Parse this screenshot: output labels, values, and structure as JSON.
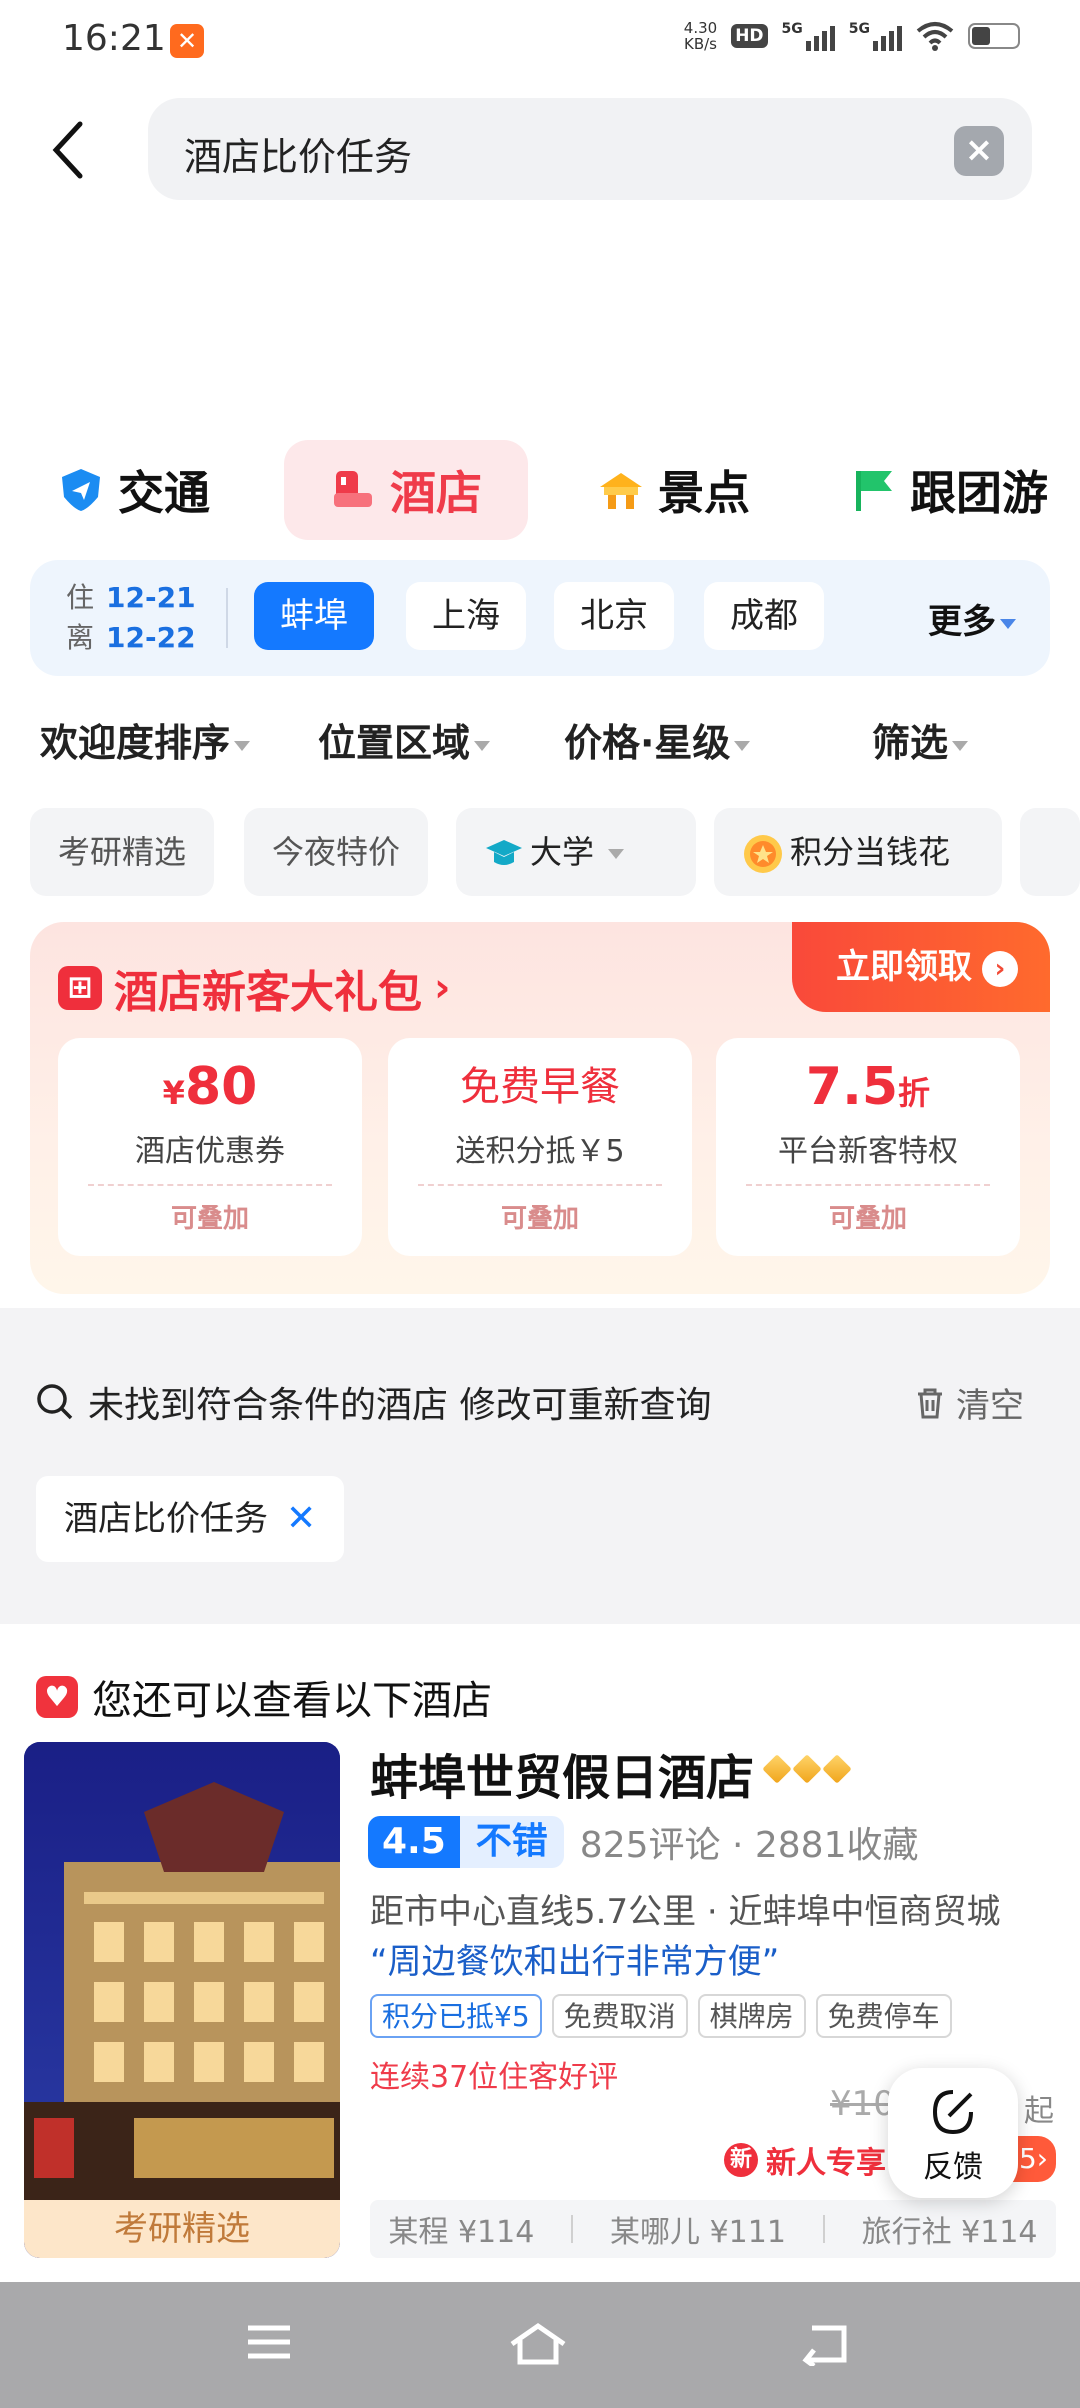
{
  "status": {
    "time": "16:21",
    "net_speed": "4.30",
    "net_unit": "KB/s",
    "hd": "HD",
    "sim1": "5G",
    "sim2": "5G"
  },
  "search": {
    "query": "酒店比价任务"
  },
  "categories": [
    {
      "label": "交通",
      "icon": "transport-icon"
    },
    {
      "label": "酒店",
      "icon": "hotel-icon"
    },
    {
      "label": "景点",
      "icon": "attraction-icon"
    },
    {
      "label": "跟团游",
      "icon": "flag-icon"
    }
  ],
  "filter": {
    "checkin_label": "住",
    "checkin": "12-21",
    "checkout_label": "离",
    "checkout": "12-22",
    "cities": [
      "蚌埠",
      "上海",
      "北京",
      "成都"
    ],
    "more": "更多"
  },
  "sorts": [
    "欢迎度排序",
    "位置区域",
    "价格·星级",
    "筛选"
  ],
  "chips": [
    "考研精选",
    "今夜特价",
    "大学",
    "积分当钱花"
  ],
  "gift": {
    "title": "酒店新客大礼包",
    "claim": "立即领取",
    "cards": [
      {
        "big": "80",
        "prefix": "¥",
        "sub": "酒店优惠券",
        "stack": "可叠加"
      },
      {
        "big": "免费早餐",
        "sub": "送积分抵￥5",
        "stack": "可叠加"
      },
      {
        "big": "7.5",
        "suffix": "折",
        "sub": "平台新客特权",
        "stack": "可叠加"
      }
    ]
  },
  "noresult": {
    "message": "未找到符合条件的酒店 修改可重新查询",
    "clear": "清空",
    "tag": "酒店比价任务"
  },
  "recommend": {
    "heading": "您还可以查看以下酒店",
    "hotel": {
      "name": "蚌埠世贸假日酒店",
      "image_badge": "考研精选",
      "score": "4.5",
      "level": "不错",
      "reviews": "825评论",
      "favorites": "2881收藏",
      "distance": "距市中心直线5.7公里 · 近蚌埠中恒商贸城",
      "quote": "“周边餐饮和出行非常方便”",
      "tags": [
        "积分已抵¥5",
        "免费取消",
        "棋牌房",
        "免费停车"
      ],
      "praise": "连续37位住客好评",
      "old_price": "¥10",
      "price_suffix": "起",
      "newbie": "新人专享",
      "newbie_pill": "5",
      "compare": [
        "某程 ¥114",
        "某哪儿 ¥111",
        "旅行社 ¥114"
      ]
    }
  },
  "feedback": {
    "label": "反馈"
  }
}
